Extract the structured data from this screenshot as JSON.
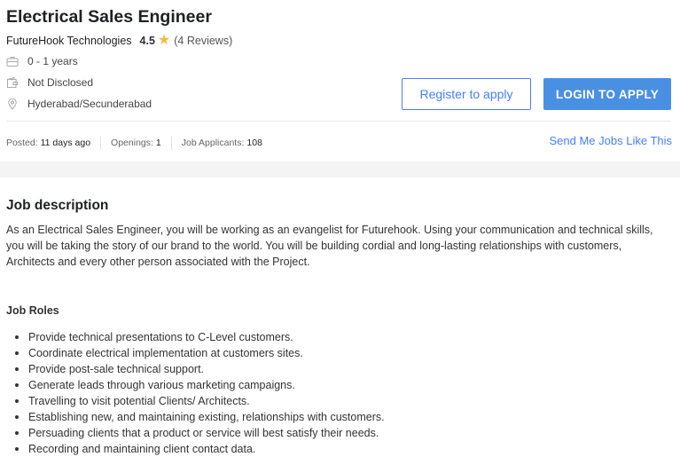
{
  "job": {
    "title": "Electrical Sales Engineer",
    "company": "FutureHook Technologies",
    "rating": "4.5",
    "reviews": "(4 Reviews)",
    "experience": "0 - 1 years",
    "salary": "Not Disclosed",
    "location": "Hyderabad/Secunderabad"
  },
  "actions": {
    "register_label": "Register to apply",
    "login_label": "LOGIN TO APPLY",
    "send_jobs_label": "Send Me Jobs Like This"
  },
  "stats": {
    "posted_label": "Posted:",
    "posted_value": "11 days ago",
    "openings_label": "Openings:",
    "openings_value": "1",
    "applicants_label": "Job Applicants:",
    "applicants_value": "108"
  },
  "description": {
    "heading": "Job description",
    "text": "As an Electrical Sales Engineer, you will be working as an evangelist for Futurehook. Using your communication and technical skills, you will be taking the story of our brand to the world. You will be building cordial and long-lasting relationships with customers, Architects and every other person associated with the Project.",
    "roles_heading": "Job Roles",
    "roles": [
      "Provide technical presentations to C-Level customers.",
      "Coordinate electrical implementation at customers sites.",
      "Provide post-sale technical support.",
      "Generate leads through various marketing campaigns.",
      "Travelling to visit potential Clients/ Architects.",
      "Establishing new, and maintaining existing, relationships with customers.",
      "Persuading clients that a product or service will best satisfy their needs.",
      "Recording and maintaining client contact data."
    ]
  },
  "colors": {
    "accent": "#457eff",
    "login_button": "#4a90e2",
    "star": "#f5b942"
  },
  "icons": {
    "experience": "briefcase-icon",
    "salary": "wallet-icon",
    "location": "location-pin-icon",
    "rating": "star-icon"
  }
}
